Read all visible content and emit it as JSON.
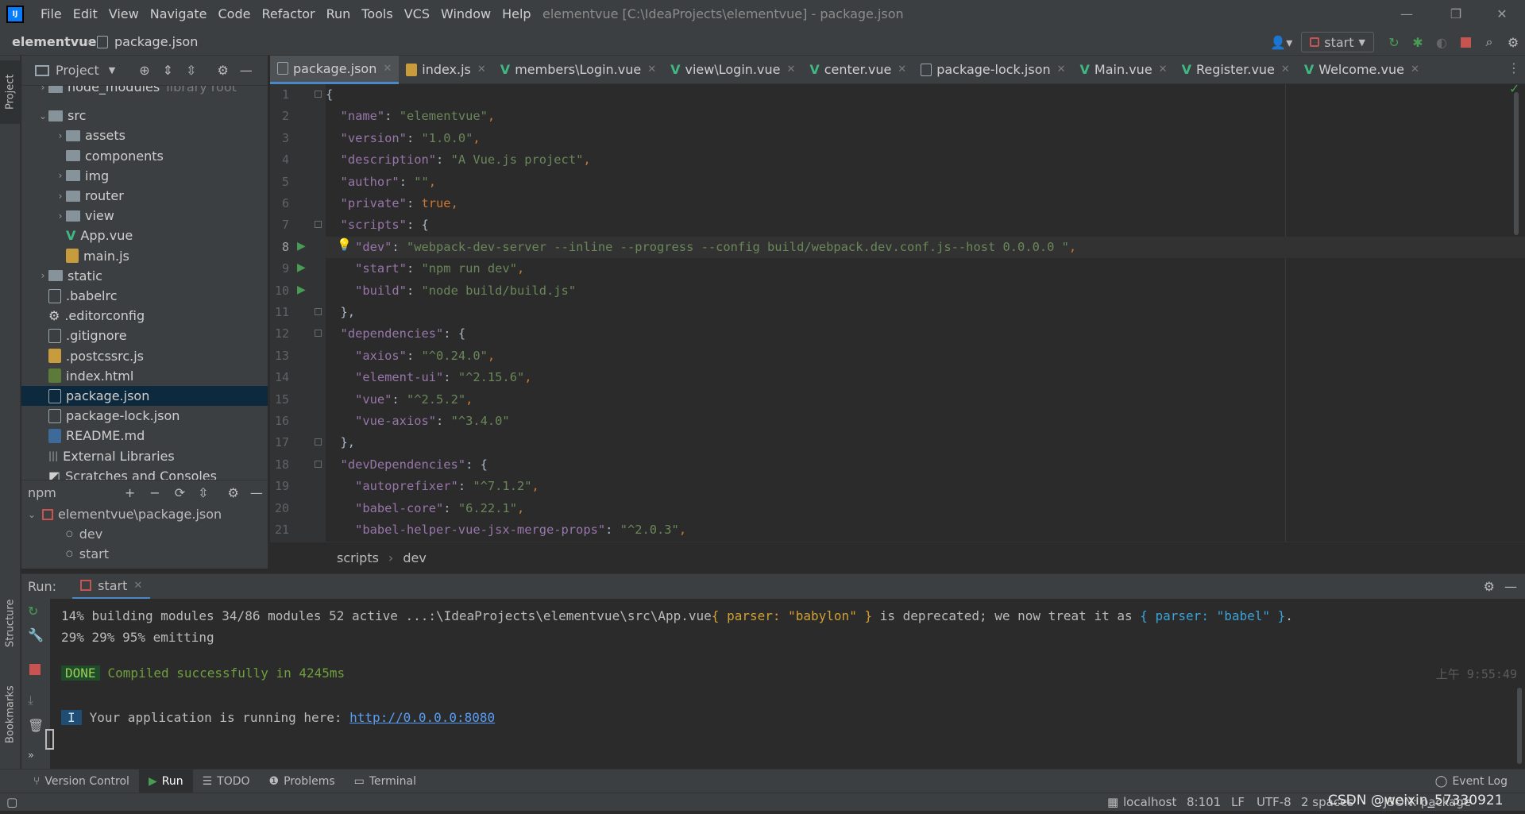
{
  "app": {
    "logo_text": "IJ",
    "window_title": "elementvue [C:\\IdeaProjects\\elementvue] - package.json",
    "menu": [
      "File",
      "Edit",
      "View",
      "Navigate",
      "Code",
      "Refactor",
      "Run",
      "Tools",
      "VCS",
      "Window",
      "Help"
    ]
  },
  "navbar": {
    "project": "elementvue",
    "file": "package.json",
    "run_config": "start"
  },
  "project_panel": {
    "title": "Project",
    "tree": [
      {
        "label": "node_modules",
        "hint": "library root",
        "depth": 1,
        "type": "folder",
        "arrow": "›"
      },
      {
        "label": "src",
        "depth": 1,
        "type": "folder",
        "arrow": "⌄"
      },
      {
        "label": "assets",
        "depth": 2,
        "type": "folder",
        "arrow": "›"
      },
      {
        "label": "components",
        "depth": 2,
        "type": "folder",
        "arrow": ""
      },
      {
        "label": "img",
        "depth": 2,
        "type": "folder",
        "arrow": "›"
      },
      {
        "label": "router",
        "depth": 2,
        "type": "folder",
        "arrow": "›"
      },
      {
        "label": "view",
        "depth": 2,
        "type": "folder",
        "arrow": "›"
      },
      {
        "label": "App.vue",
        "depth": 2,
        "type": "vue",
        "arrow": ""
      },
      {
        "label": "main.js",
        "depth": 2,
        "type": "js",
        "arrow": ""
      },
      {
        "label": "static",
        "depth": 1,
        "type": "folder",
        "arrow": "›"
      },
      {
        "label": ".babelrc",
        "depth": 1,
        "type": "json",
        "arrow": ""
      },
      {
        "label": ".editorconfig",
        "depth": 1,
        "type": "gear",
        "arrow": ""
      },
      {
        "label": ".gitignore",
        "depth": 1,
        "type": "text",
        "arrow": ""
      },
      {
        "label": ".postcssrc.js",
        "depth": 1,
        "type": "js",
        "arrow": ""
      },
      {
        "label": "index.html",
        "depth": 1,
        "type": "html",
        "arrow": ""
      },
      {
        "label": "package.json",
        "depth": 1,
        "type": "json",
        "arrow": "",
        "selected": true
      },
      {
        "label": "package-lock.json",
        "depth": 1,
        "type": "json",
        "arrow": ""
      },
      {
        "label": "README.md",
        "depth": 1,
        "type": "md",
        "arrow": ""
      },
      {
        "label": "External Libraries",
        "depth": 0,
        "type": "lib",
        "arrow": ""
      },
      {
        "label": "Scratches and Consoles",
        "depth": 0,
        "type": "scratch",
        "arrow": ""
      }
    ]
  },
  "npm_panel": {
    "title": "npm",
    "root": "elementvue\\package.json",
    "scripts": [
      "dev",
      "start"
    ]
  },
  "side_tabs": {
    "project": "Project",
    "structure": "Structure",
    "bookmarks": "Bookmarks",
    "npm": "npm"
  },
  "editor_tabs": [
    {
      "label": "package.json",
      "icon": "json",
      "active": true
    },
    {
      "label": "index.js",
      "icon": "js"
    },
    {
      "label": "members\\Login.vue",
      "icon": "vue"
    },
    {
      "label": "view\\Login.vue",
      "icon": "vue"
    },
    {
      "label": "center.vue",
      "icon": "vue"
    },
    {
      "label": "package-lock.json",
      "icon": "json"
    },
    {
      "label": "Main.vue",
      "icon": "vue"
    },
    {
      "label": "Register.vue",
      "icon": "vue"
    },
    {
      "label": "Welcome.vue",
      "icon": "vue"
    }
  ],
  "code_lines": [
    {
      "n": "1",
      "t": [
        [
          "b",
          "{"
        ]
      ]
    },
    {
      "n": "2",
      "t": [
        [
          "b",
          "  "
        ],
        [
          "k",
          "\"name\""
        ],
        [
          "b",
          ": "
        ],
        [
          "s",
          "\"elementvue\""
        ],
        [
          "p",
          ","
        ]
      ]
    },
    {
      "n": "3",
      "t": [
        [
          "b",
          "  "
        ],
        [
          "k",
          "\"version\""
        ],
        [
          "b",
          ": "
        ],
        [
          "s",
          "\"1.0.0\""
        ],
        [
          "p",
          ","
        ]
      ]
    },
    {
      "n": "4",
      "t": [
        [
          "b",
          "  "
        ],
        [
          "k",
          "\"description\""
        ],
        [
          "b",
          ": "
        ],
        [
          "s",
          "\"A Vue.js project\""
        ],
        [
          "p",
          ","
        ]
      ]
    },
    {
      "n": "5",
      "t": [
        [
          "b",
          "  "
        ],
        [
          "k",
          "\"author\""
        ],
        [
          "b",
          ": "
        ],
        [
          "s",
          "\"\""
        ],
        [
          "p",
          ","
        ]
      ]
    },
    {
      "n": "6",
      "t": [
        [
          "b",
          "  "
        ],
        [
          "k",
          "\"private\""
        ],
        [
          "b",
          ": "
        ],
        [
          "p",
          "true,"
        ]
      ]
    },
    {
      "n": "7",
      "t": [
        [
          "b",
          "  "
        ],
        [
          "k",
          "\"scripts\""
        ],
        [
          "b",
          ": {"
        ]
      ]
    },
    {
      "n": "8",
      "t": [
        [
          "b",
          "    "
        ],
        [
          "k",
          "\"dev\""
        ],
        [
          "b",
          ": "
        ],
        [
          "s",
          "\"webpack-dev-server --inline --progress --config build/webpack.dev.conf.js--host 0.0.0.0 \""
        ],
        [
          "p",
          ","
        ]
      ],
      "cur": true,
      "run": true
    },
    {
      "n": "9",
      "t": [
        [
          "b",
          "    "
        ],
        [
          "k",
          "\"start\""
        ],
        [
          "b",
          ": "
        ],
        [
          "s",
          "\"npm run dev\""
        ],
        [
          "p",
          ","
        ]
      ],
      "run": true
    },
    {
      "n": "10",
      "t": [
        [
          "b",
          "    "
        ],
        [
          "k",
          "\"build\""
        ],
        [
          "b",
          ": "
        ],
        [
          "s",
          "\"node build/build.js\""
        ]
      ],
      "run": true
    },
    {
      "n": "11",
      "t": [
        [
          "b",
          "  },"
        ]
      ]
    },
    {
      "n": "12",
      "t": [
        [
          "b",
          "  "
        ],
        [
          "k",
          "\"dependencies\""
        ],
        [
          "b",
          ": {"
        ]
      ]
    },
    {
      "n": "13",
      "t": [
        [
          "b",
          "    "
        ],
        [
          "k",
          "\"axios\""
        ],
        [
          "b",
          ": "
        ],
        [
          "s",
          "\"^0.24.0\""
        ],
        [
          "p",
          ","
        ]
      ]
    },
    {
      "n": "14",
      "t": [
        [
          "b",
          "    "
        ],
        [
          "k",
          "\"element-ui\""
        ],
        [
          "b",
          ": "
        ],
        [
          "s",
          "\"^2.15.6\""
        ],
        [
          "p",
          ","
        ]
      ]
    },
    {
      "n": "15",
      "t": [
        [
          "b",
          "    "
        ],
        [
          "k",
          "\"vue\""
        ],
        [
          "b",
          ": "
        ],
        [
          "s",
          "\"^2.5.2\""
        ],
        [
          "p",
          ","
        ]
      ]
    },
    {
      "n": "16",
      "t": [
        [
          "b",
          "    "
        ],
        [
          "k",
          "\"vue-axios\""
        ],
        [
          "b",
          ": "
        ],
        [
          "s",
          "\"^3.4.0\""
        ]
      ]
    },
    {
      "n": "17",
      "t": [
        [
          "b",
          "  },"
        ]
      ]
    },
    {
      "n": "18",
      "t": [
        [
          "b",
          "  "
        ],
        [
          "k",
          "\"devDependencies\""
        ],
        [
          "b",
          ": {"
        ]
      ]
    },
    {
      "n": "19",
      "t": [
        [
          "b",
          "    "
        ],
        [
          "k",
          "\"autoprefixer\""
        ],
        [
          "b",
          ": "
        ],
        [
          "s",
          "\"^7.1.2\""
        ],
        [
          "p",
          ","
        ]
      ]
    },
    {
      "n": "20",
      "t": [
        [
          "b",
          "    "
        ],
        [
          "k",
          "\"babel-core\""
        ],
        [
          "b",
          ": "
        ],
        [
          "s",
          "\"6.22.1\""
        ],
        [
          "p",
          ","
        ]
      ]
    },
    {
      "n": "21",
      "t": [
        [
          "b",
          "    "
        ],
        [
          "k",
          "\"babel-helper-vue-jsx-merge-props\""
        ],
        [
          "b",
          ": "
        ],
        [
          "s",
          "\"^2.0.3\""
        ],
        [
          "p",
          ","
        ]
      ]
    }
  ],
  "breadcrumbs": [
    "scripts",
    "dev"
  ],
  "run_panel": {
    "label": "Run:",
    "tab": "start",
    "console": {
      "line1_prefix": "14% building modules 34/86 modules 52 active ...:\\IdeaProjects\\elementvue\\src\\App.vue",
      "line1_warn1": "{ parser: \"babylon\" }",
      "line1_mid": " is deprecated; we now treat it as ",
      "line1_warn2": "{ parser: \"babel\" }",
      "line1_end": ".",
      "line2": "29% 29% 95% emitting",
      "done_badge": "DONE",
      "done_text": "Compiled successfully in 4245ms",
      "timestamp": "上午 9:55:49",
      "info_badge": "I",
      "info_text": "Your application is running here: ",
      "info_link": "http://0.0.0.0:8080"
    }
  },
  "toolwindow_tabs": [
    "Version Control",
    "Run",
    "TODO",
    "Problems",
    "Terminal"
  ],
  "event_log": "Event Log",
  "status": {
    "host": "localhost",
    "position": "8:101",
    "line_sep": "LF",
    "encoding": "UTF-8",
    "indent": "2 spaces",
    "schema": "JSON: package",
    "watermark": "CSDN @weixin_57330921"
  },
  "colors": {
    "accent": "#4a88c7",
    "run_green": "#499c54",
    "stop_red": "#c75450",
    "vue_green": "#41b883"
  }
}
